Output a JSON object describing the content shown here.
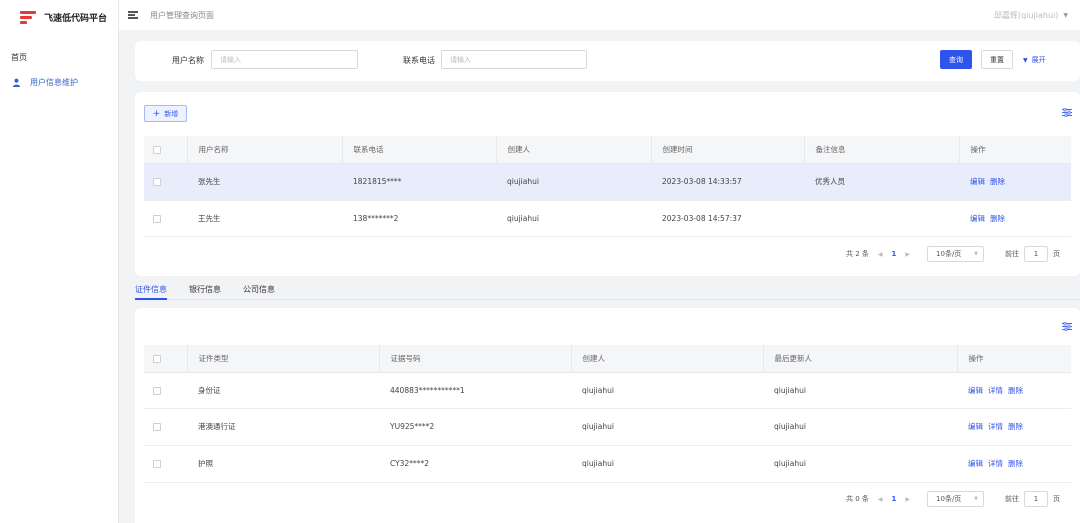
{
  "app": {
    "title": "飞速低代码平台"
  },
  "sidebar": {
    "group": "首页",
    "items": [
      {
        "label": "用户信息维护"
      }
    ]
  },
  "header": {
    "breadcrumb": "用户管理查询页面",
    "user": "邱嘉辉(qiujiahui)"
  },
  "search": {
    "name_label": "用户名称",
    "name_placeholder": "请输入",
    "phone_label": "联系电话",
    "phone_placeholder": "请输入",
    "query_label": "查询",
    "reset_label": "重置",
    "expand_label": "展开"
  },
  "users": {
    "add_label": "新增",
    "columns": [
      "用户名称",
      "联系电话",
      "创建人",
      "创建时间",
      "备注信息",
      "操作"
    ],
    "rows": [
      {
        "name": "张先生",
        "phone": "1821815****",
        "creator": "qiujiahui",
        "created": "2023-03-08 14:33:57",
        "remark": "优秀人员",
        "edit": "编辑",
        "delete": "删除"
      },
      {
        "name": "王先生",
        "phone": "138*******2",
        "creator": "qiujiahui",
        "created": "2023-03-08 14:57:37",
        "remark": "",
        "edit": "编辑",
        "delete": "删除"
      }
    ],
    "pagination": {
      "total": "共 2 条",
      "page": "1",
      "page_size": "10条/页",
      "goto_label": "前往",
      "goto_value": "1",
      "page_unit": "页"
    }
  },
  "tabs": [
    {
      "label": "证件信息",
      "active": true
    },
    {
      "label": "银行信息",
      "active": false
    },
    {
      "label": "公司信息",
      "active": false
    }
  ],
  "certs": {
    "columns": [
      "证件类型",
      "证据号码",
      "创建人",
      "最后更新人",
      "操作"
    ],
    "rows": [
      {
        "type": "身份证",
        "number": "440883***********1",
        "creator": "qiujiahui",
        "updater": "qiujiahui",
        "edit": "编辑",
        "detail": "详情",
        "delete": "删除"
      },
      {
        "type": "港澳通行证",
        "number": "YU925****2",
        "creator": "qiujiahui",
        "updater": "qiujiahui",
        "edit": "编辑",
        "detail": "详情",
        "delete": "删除"
      },
      {
        "type": "护照",
        "number": "CY32****2",
        "creator": "qiujiahui",
        "updater": "qiujiahui",
        "edit": "编辑",
        "detail": "详情",
        "delete": "删除"
      }
    ],
    "pagination": {
      "total": "共 0 条",
      "page": "1",
      "page_size": "10条/页",
      "goto_label": "前往",
      "goto_value": "1",
      "page_unit": "页"
    }
  },
  "colors": {
    "accent": "#2f54eb",
    "logo": "#e4393c",
    "highlight_row": "#e8ecfb"
  },
  "icons": [
    "logo-icon",
    "menu-fold-icon",
    "user-icon",
    "chevron-down-icon",
    "plus-icon",
    "column-settings-icon"
  ]
}
